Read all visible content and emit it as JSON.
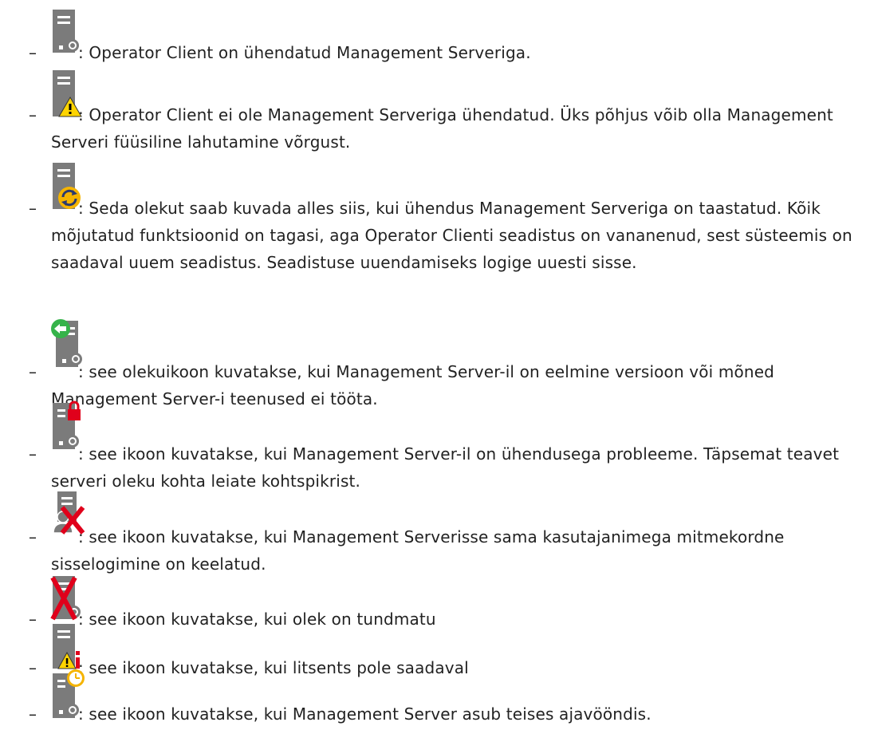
{
  "items": [
    {
      "icon": "server-connected-icon",
      "text": ": Operator Client on ühendatud Management Serveriga."
    },
    {
      "icon": "server-warning-icon",
      "text": ": Operator Client ei ole Management Serveriga ühendatud. Üks põhjus võib olla Management Serveri füüsiline lahutamine võrgust."
    },
    {
      "icon": "server-refresh-icon",
      "text": ": Seda olekut saab kuvada alles siis, kui ühendus Management Serveriga on taastatud. Kõik mõjutatud funktsioonid on tagasi, aga Operator Clienti seadistus on vananenud, sest süsteemis on saadaval uuem seadistus. Seadistuse uuendamiseks logige uuesti sisse."
    },
    {
      "icon": "server-old-version-icon",
      "text": ": see olekuikoon kuvatakse, kui Management Server-il on eelmine versioon või mõned Management Server-i teenused ei tööta."
    },
    {
      "icon": "server-locked-icon",
      "text": ": see ikoon kuvatakse, kui Management Server-il on ühendusega probleeme. Täpsemat teavet serveri oleku kohta leiate kohtspikrist."
    },
    {
      "icon": "server-multi-login-denied-icon",
      "text": ": see ikoon kuvatakse, kui Management Serverisse sama kasutajanimega mitmekordne sisselogimine on keelatud."
    },
    {
      "icon": "server-unknown-icon",
      "text": ": see ikoon kuvatakse, kui olek on tundmatu"
    },
    {
      "icon": "server-license-icon",
      "text": ": see ikoon kuvatakse, kui litsents pole saadaval"
    },
    {
      "icon": "server-timezone-icon",
      "text": ": see ikoon kuvatakse, kui Management Server asub teises ajavööndis."
    }
  ],
  "dash": "–",
  "colors": {
    "server": "#7b7b7b",
    "warning": "#ffd400",
    "green": "#36b34a",
    "red": "#e0001b",
    "refresh": "#f5b400",
    "clock": "#f5b400"
  }
}
